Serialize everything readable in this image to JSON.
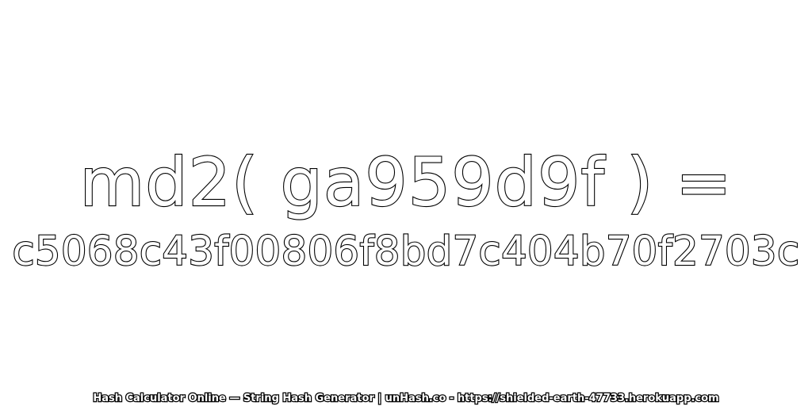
{
  "expression": "md2( ga959d9f ) =",
  "hash_result": "c5068c43f00806f8bd7c404b70f2703c",
  "footer": "Hash Calculator Online — String Hash Generator | unHash.co - https://shielded-earth-47733.herokuapp.com",
  "colors": {
    "background": "#ffffff",
    "text_fill": "#ffffff",
    "text_outline": "#000000"
  }
}
